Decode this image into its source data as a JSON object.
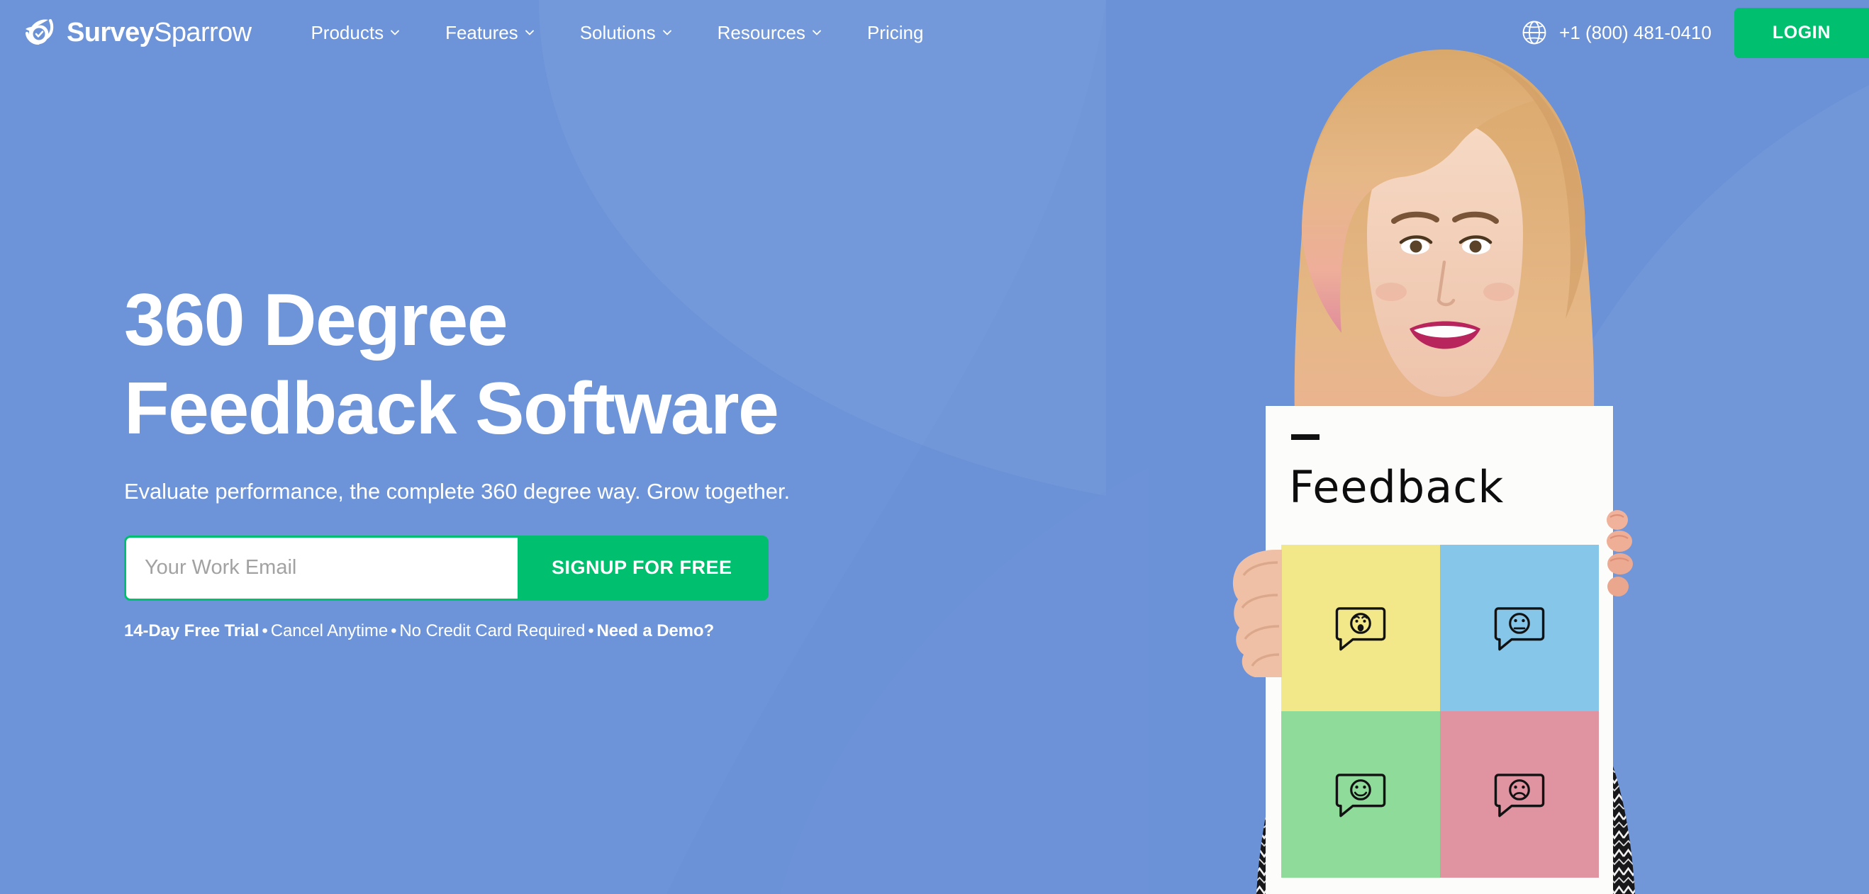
{
  "brand": {
    "name_bold": "Survey",
    "name_light": "Sparrow",
    "logo_icon": "sparrow-bird-check-logo",
    "accent_green": "#00bf6f",
    "background_blue": "#6b91d6"
  },
  "header": {
    "nav": [
      {
        "label": "Products",
        "has_dropdown": true,
        "icon": "chevron-down-icon"
      },
      {
        "label": "Features",
        "has_dropdown": true,
        "icon": "chevron-down-icon"
      },
      {
        "label": "Solutions",
        "has_dropdown": true,
        "icon": "chevron-down-icon"
      },
      {
        "label": "Resources",
        "has_dropdown": true,
        "icon": "chevron-down-icon"
      },
      {
        "label": "Pricing",
        "has_dropdown": false,
        "icon": ""
      }
    ],
    "globe_icon": "globe-icon",
    "phone": "+1 (800) 481-0410",
    "login_label": "LOGIN"
  },
  "hero": {
    "headline_line1": "360 Degree",
    "headline_line2": "Feedback Software",
    "subheadline": "Evaluate performance, the complete 360 degree way. Grow together.",
    "email_placeholder": "Your Work Email",
    "email_value": "",
    "signup_label": "SIGNUP FOR FREE",
    "trial": {
      "bold_1": "14-Day Free Trial",
      "plain_1": "Cancel Anytime",
      "plain_2": "No Credit Card Required",
      "bold_2": "Need a Demo?",
      "separator": "•"
    }
  },
  "board": {
    "dash_mark": "-",
    "title": "Feedback",
    "quadrants": [
      {
        "name": "surprised-face-bubble",
        "color": "#f2e88a",
        "face": "surprised"
      },
      {
        "name": "neutral-face-bubble",
        "color": "#86c6e8",
        "face": "neutral"
      },
      {
        "name": "happy-face-bubble",
        "color": "#8edb9a",
        "face": "happy"
      },
      {
        "name": "sad-face-bubble",
        "color": "#e093a0",
        "face": "sad"
      }
    ]
  }
}
